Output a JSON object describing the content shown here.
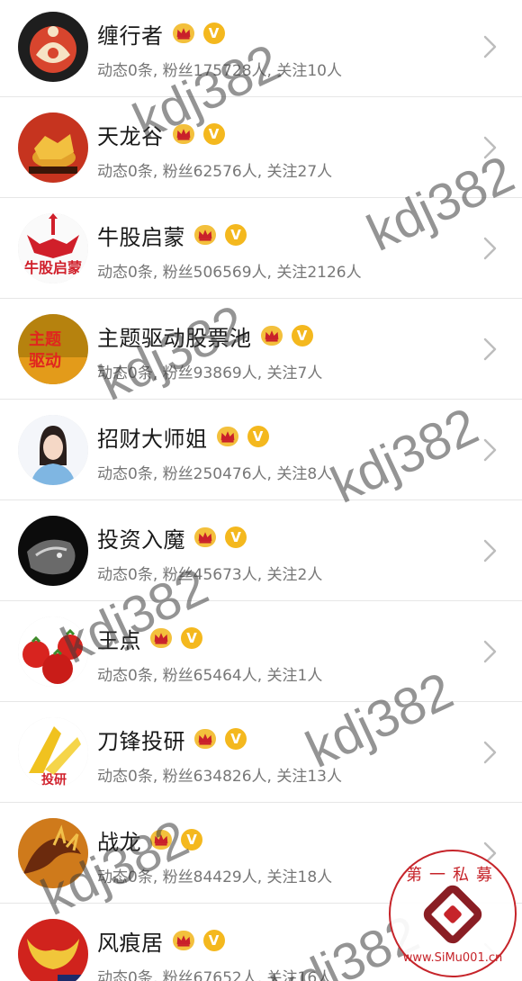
{
  "users": [
    {
      "name": "缠行者",
      "stats": "动态0条, 粉丝175728人, 关注10人",
      "avatar": "kundalini-avatar"
    },
    {
      "name": "天龙谷",
      "stats": "动态0条, 粉丝62576人, 关注27人",
      "avatar": "golden-bull-avatar"
    },
    {
      "name": "牛股启蒙",
      "stats": "动态0条, 粉丝506569人, 关注2126人",
      "avatar": "bull-logo-avatar",
      "avatar_text": "牛股启蒙"
    },
    {
      "name": "主题驱动股票池",
      "stats": "动态0条, 粉丝93869人, 关注7人",
      "avatar": "theme-drive-avatar",
      "avatar_text": "主题驱动"
    },
    {
      "name": "招财大师姐",
      "stats": "动态0条, 粉丝250476人, 关注8人",
      "avatar": "woman-portrait-avatar"
    },
    {
      "name": "投资入魔",
      "stats": "动态0条, 粉丝45673人, 关注2人",
      "avatar": "lion-avatar"
    },
    {
      "name": "王点",
      "stats": "动态0条, 粉丝65464人, 关注1人",
      "avatar": "tomatoes-avatar"
    },
    {
      "name": "刀锋投研",
      "stats": "动态0条, 粉丝634826人, 关注13人",
      "avatar": "blade-research-avatar",
      "avatar_text": "投研"
    },
    {
      "name": "战龙",
      "stats": "动态0条, 粉丝84429人, 关注18人",
      "avatar": "dragon-avatar"
    },
    {
      "name": "风痕居",
      "stats": "动态0条, 粉丝67652人, 关注16人",
      "avatar": "red-bull-avatar"
    }
  ],
  "badges": {
    "vip_icon": "crown-icon",
    "verified_label": "V"
  },
  "watermark": "kdj382",
  "site_logo": {
    "top_text": "第一私募",
    "url_text": "www.SiMu001.cn"
  },
  "colors": {
    "badge_gold": "#f4b81e",
    "crown": "#f3c03c",
    "logo_red": "#c6242a"
  }
}
